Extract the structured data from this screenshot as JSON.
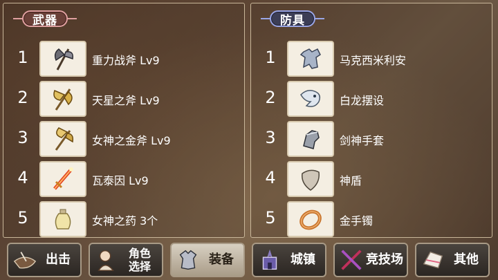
{
  "weapons": {
    "title": "武器",
    "items": [
      {
        "num": "1",
        "name": "重力战斧 Lv9",
        "icon": "battle-axe-icon"
      },
      {
        "num": "2",
        "name": "天星之斧 Lv9",
        "icon": "gold-axe-icon"
      },
      {
        "num": "3",
        "name": "女神之金斧 Lv9",
        "icon": "goddess-axe-icon"
      },
      {
        "num": "4",
        "name": "瓦泰因 Lv9",
        "icon": "flame-sword-icon"
      },
      {
        "num": "5",
        "name": "女神之药 3个",
        "icon": "potion-icon"
      }
    ]
  },
  "armor": {
    "title": "防具",
    "items": [
      {
        "num": "1",
        "name": "马克西米利安",
        "icon": "plate-armor-icon"
      },
      {
        "num": "2",
        "name": "白龙摆设",
        "icon": "white-dragon-icon"
      },
      {
        "num": "3",
        "name": "剑神手套",
        "icon": "gauntlet-icon"
      },
      {
        "num": "4",
        "name": "神盾",
        "icon": "shield-icon"
      },
      {
        "num": "5",
        "name": "金手镯",
        "icon": "bracelet-icon"
      }
    ]
  },
  "nav": [
    {
      "label": "出击",
      "icon": "sortie-icon",
      "active": false
    },
    {
      "label": "角色\n选择",
      "icon": "character-icon",
      "active": false
    },
    {
      "label": "装备",
      "icon": "equipment-icon",
      "active": true
    },
    {
      "label": "城镇",
      "icon": "town-icon",
      "active": false
    },
    {
      "label": "竞技场",
      "icon": "arena-icon",
      "active": false
    },
    {
      "label": "其他",
      "icon": "other-icon",
      "active": false
    }
  ]
}
